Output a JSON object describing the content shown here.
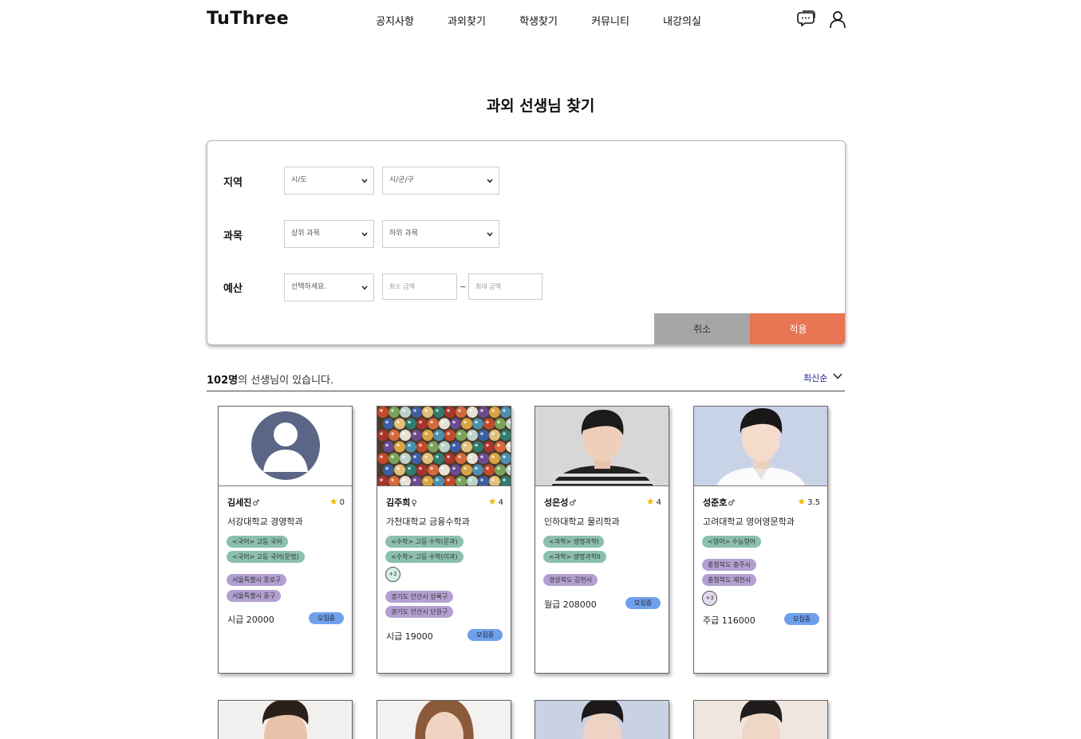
{
  "header": {
    "logo": "TuThree",
    "nav": [
      "공지사항",
      "과외찾기",
      "학생찾기",
      "커뮤니티",
      "내강의실"
    ],
    "icons": [
      "chat-icon",
      "user-icon"
    ]
  },
  "page_title": "과외 선생님 찾기",
  "filter": {
    "region_label": "지역",
    "region_city": "시/도",
    "region_district": "시/군/구",
    "subject_label": "과목",
    "subject_top": "상위 과목",
    "subject_sub": "하위 과목",
    "budget_label": "예산",
    "budget_type": "선택하세요.",
    "budget_min_placeholder": "최소 금액",
    "budget_max_placeholder": "최대 금액",
    "tilde": "~",
    "cancel": "취소",
    "apply": "적용"
  },
  "results": {
    "count": "102명",
    "suffix": "의 선생님이 있습니다.",
    "sort": "최신순"
  },
  "cards": [
    {
      "name": "김세진",
      "gender": "♂",
      "rating": "0",
      "school": "서강대학교 경영학과",
      "subjects": [
        "<국어> 고등 국어",
        "<국어> 고등 국어(문법)"
      ],
      "subjects_more": "",
      "regions": [
        "서울특별시 종로구",
        "서울특별시 중구"
      ],
      "regions_more": "",
      "pay": "시급 20000",
      "status": "모집중"
    },
    {
      "name": "김주희",
      "gender": "♀",
      "rating": "4",
      "school": "가천대학교 금융수학과",
      "subjects": [
        "<수학> 고등 수학(문과)",
        "<수학> 고등 수학(이과)"
      ],
      "subjects_more": "+2",
      "regions": [
        "경기도 안산시 상록구",
        "경기도 안산시 단원구"
      ],
      "regions_more": "",
      "pay": "시급 19000",
      "status": "모집중"
    },
    {
      "name": "성은성",
      "gender": "♂",
      "rating": "4",
      "school": "인하대학교 물리학과",
      "subjects": [
        "<과학> 생명과학I",
        "<과학> 생명과학II"
      ],
      "subjects_more": "",
      "regions": [
        "경상북도 김천시"
      ],
      "regions_more": "",
      "pay": "월급 208000",
      "status": "모집중"
    },
    {
      "name": "성준호",
      "gender": "♂",
      "rating": "3.5",
      "school": "고려대학교 영어영문학과",
      "subjects": [
        "<영어> 수능영어"
      ],
      "subjects_more": "",
      "regions": [
        "충청북도 충주시",
        "충청북도 제천시"
      ],
      "regions_more": "+3",
      "pay": "주급 116000",
      "status": "모집중"
    }
  ]
}
